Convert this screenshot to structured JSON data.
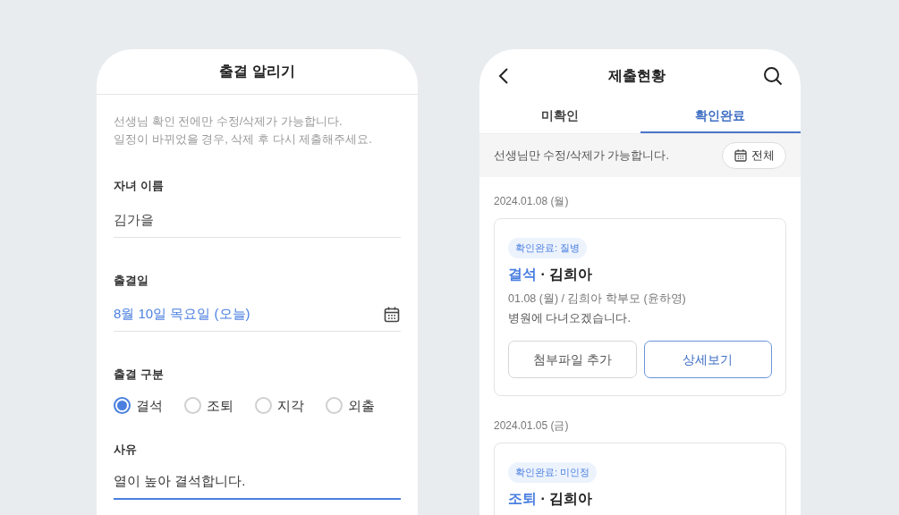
{
  "form_screen": {
    "title": "출결 알리기",
    "notice": [
      "선생님 확인 전에만 수정/삭제가 가능합니다.",
      "일정이 바뀌었을 경우, 삭제 후 다시 제출해주세요."
    ],
    "child_name": {
      "label": "자녀 이름",
      "value": "김가을"
    },
    "date": {
      "label": "출결일",
      "value": "8월 10일 목요일 (오늘)"
    },
    "attendance_type": {
      "label": "출결 구분",
      "options": [
        {
          "label": "결석",
          "selected": true
        },
        {
          "label": "조퇴",
          "selected": false
        },
        {
          "label": "지각",
          "selected": false
        },
        {
          "label": "외출",
          "selected": false
        }
      ]
    },
    "reason": {
      "label": "사유",
      "value": "열이 높아 결석합니다."
    }
  },
  "status_screen": {
    "title": "제출현황",
    "tabs": [
      {
        "label": "미확인",
        "selected": false
      },
      {
        "label": "확인완료",
        "selected": true
      }
    ],
    "notice": "선생님만 수정/삭제가 가능합니다.",
    "filter_button": "전체",
    "groups": [
      {
        "date": "2024.01.08 (월)",
        "card": {
          "badge": "확인완료: 질병",
          "type": "결석",
          "rest": "· 김희아",
          "meta": "01.08 (월) / 김희아 학부모 (윤하영)",
          "message": "병원에 다녀오겠습니다.",
          "buttons": [
            {
              "label": "첨부파일 추가",
              "kind": "secondary"
            },
            {
              "label": "상세보기",
              "kind": "primary"
            }
          ]
        }
      },
      {
        "date": "2024.01.05 (금)",
        "card": {
          "badge": "확인완료: 미인정",
          "type": "조퇴",
          "rest": "· 김희아"
        }
      }
    ]
  }
}
